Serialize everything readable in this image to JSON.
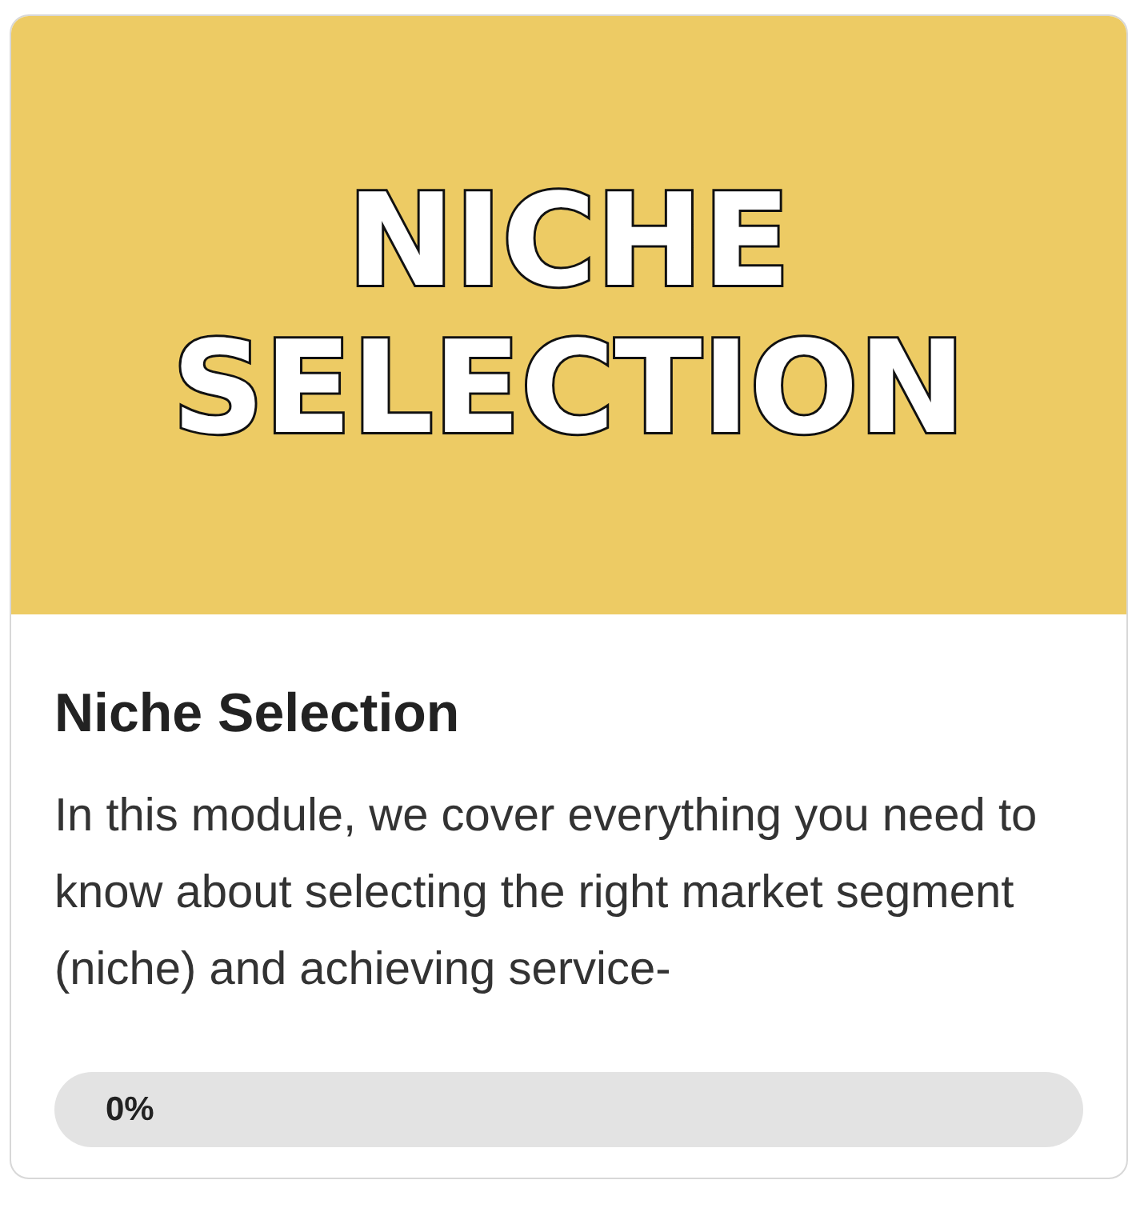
{
  "banner": {
    "lines": [
      "NICHE",
      "SELECTION"
    ]
  },
  "module": {
    "title": "Niche Selection",
    "description": "In this module, we cover everything you need to know about selecting the right market segment (niche) and achieving service-"
  },
  "progress": {
    "level": 0,
    "reading": "0%"
  }
}
